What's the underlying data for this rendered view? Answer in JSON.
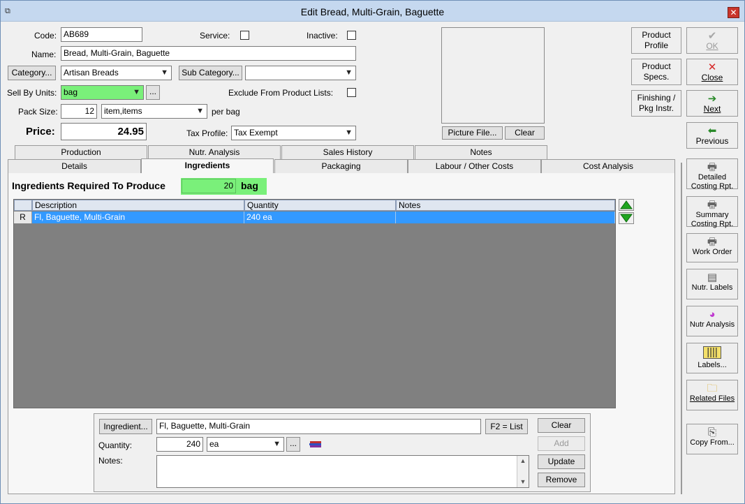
{
  "window": {
    "title": "Edit Bread, Multi-Grain, Baguette"
  },
  "form": {
    "code_label": "Code:",
    "code_value": "AB689",
    "service_label": "Service:",
    "inactive_label": "Inactive:",
    "name_label": "Name:",
    "name_value": "Bread, Multi-Grain, Baguette",
    "category_button": "Category...",
    "category_value": "Artisan Breads",
    "subcategory_button": "Sub Category...",
    "subcategory_value": "",
    "sell_by_label": "Sell By Units:",
    "sell_by_value": "bag",
    "ellipsis": "...",
    "exclude_label": "Exclude From Product Lists:",
    "pack_size_label": "Pack Size:",
    "pack_size_value": "12",
    "pack_unit_value": "item,items",
    "per_unit_label": "per bag",
    "price_label": "Price:",
    "price_value": "24.95",
    "tax_label": "Tax Profile:",
    "tax_value": "Tax Exempt",
    "picture_button": "Picture File...",
    "picture_clear": "Clear"
  },
  "action_buttons": [
    {
      "label": "Product Profile"
    },
    {
      "label": "Product Specs."
    },
    {
      "label": "Finishing / Pkg Instr."
    }
  ],
  "side_buttons": [
    {
      "label": "OK",
      "icon": "checkmark-icon"
    },
    {
      "label": "Close",
      "icon": "close-icon"
    },
    {
      "label": "Next",
      "icon": "next-icon"
    },
    {
      "label": "Previous",
      "icon": "previous-icon"
    },
    {
      "label": "Detailed Costing Rpt.",
      "icon": "printer-icon"
    },
    {
      "label": "Summary Costing Rpt.",
      "icon": "printer-icon"
    },
    {
      "label": "Work Order",
      "icon": "printer-icon"
    },
    {
      "label": "Nutr. Labels",
      "icon": "nutrition-label-icon"
    },
    {
      "label": "Nutr Analysis",
      "icon": "pie-chart-icon"
    },
    {
      "label": "Labels...",
      "icon": "barcode-icon"
    },
    {
      "label": "Related Files",
      "icon": "folder-icon"
    },
    {
      "label": "Copy From...",
      "icon": "copy-icon"
    }
  ],
  "tabs_back": [
    "Production",
    "Nutr. Analysis",
    "Sales History",
    "Notes"
  ],
  "tabs_front": [
    "Details",
    "Ingredients",
    "Packaging",
    "Labour / Other Costs",
    "Cost Analysis"
  ],
  "ingredients": {
    "heading": "Ingredients Required To Produce",
    "yield_value": "20",
    "yield_unit": "bag",
    "columns": [
      "Description",
      "Quantity",
      "Notes"
    ],
    "rows": [
      {
        "marker": "R",
        "description": "Fl, Baguette, Multi-Grain",
        "quantity": "240 ea",
        "notes": ""
      }
    ]
  },
  "editor": {
    "ingredient_button": "Ingredient...",
    "ingredient_value": "Fl, Baguette, Multi-Grain",
    "list_button": "F2 = List",
    "clear_button": "Clear",
    "add_button": "Add",
    "update_button": "Update",
    "remove_button": "Remove",
    "quantity_label": "Quantity:",
    "quantity_value": "240",
    "unit_value": "ea",
    "ellipsis": "...",
    "notes_label": "Notes:",
    "notes_value": ""
  }
}
